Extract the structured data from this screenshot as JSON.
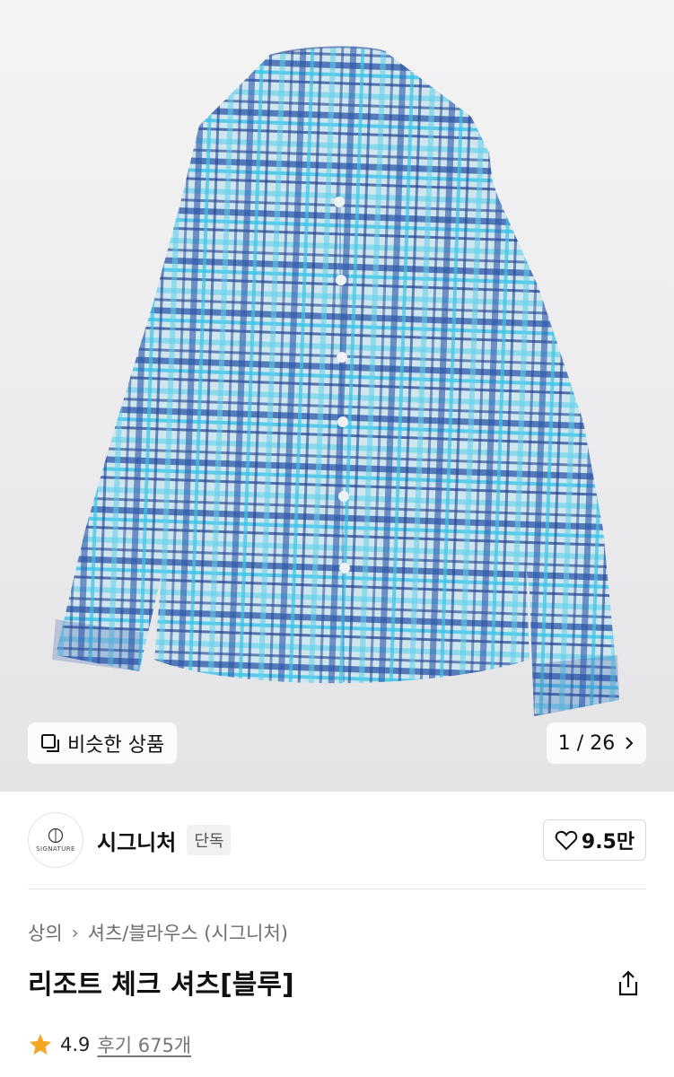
{
  "gallery": {
    "similar_label": "비슷한 상품",
    "counter": "1 / 26"
  },
  "brand": {
    "logo_text": "SIGNATURE",
    "name": "시그니처",
    "badge": "단독",
    "likes": "9.5만"
  },
  "breadcrumb": {
    "level1": "상의",
    "level2": "셔츠/블라우스 (시그니처)"
  },
  "product": {
    "title": "리조트 체크 셔츠[블루]"
  },
  "rating": {
    "score": "4.9",
    "reviews": "후기 675개"
  },
  "colors": {
    "star": "#f5a623",
    "shirt_base": "#bfe3ee",
    "check_navy": "#1f3f8f",
    "check_aqua": "#3cc3e6"
  }
}
